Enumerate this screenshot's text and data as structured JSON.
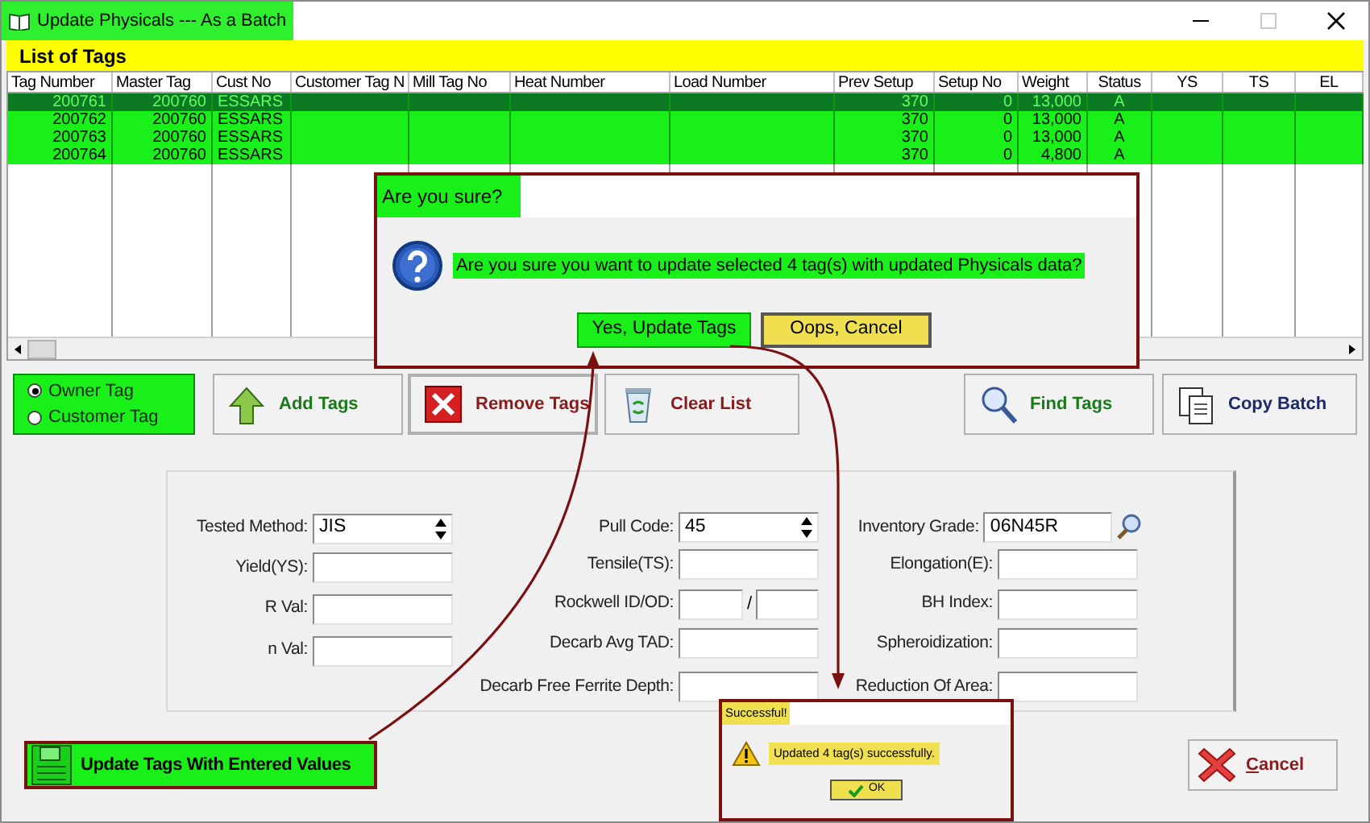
{
  "window": {
    "title": "Update Physicals --- As a Batch"
  },
  "list_header": "List of Tags",
  "table": {
    "columns": [
      "Tag Number",
      "Master Tag",
      "Cust No",
      "Customer Tag N",
      "Mill Tag No",
      "Heat Number",
      "Load Number",
      "Prev Setup",
      "Setup No",
      "Weight",
      "Status",
      "YS",
      "TS",
      "EL"
    ],
    "rows": [
      {
        "selected": true,
        "cells": [
          "200761",
          "200760",
          "ESSARS",
          "",
          "",
          "",
          "",
          "370",
          "0",
          "13,000",
          "A",
          "",
          "",
          ""
        ]
      },
      {
        "selected": false,
        "cells": [
          "200762",
          "200760",
          "ESSARS",
          "",
          "",
          "",
          "",
          "370",
          "0",
          "13,000",
          "A",
          "",
          "",
          ""
        ]
      },
      {
        "selected": false,
        "cells": [
          "200763",
          "200760",
          "ESSARS",
          "",
          "",
          "",
          "",
          "370",
          "0",
          "13,000",
          "A",
          "",
          "",
          ""
        ]
      },
      {
        "selected": false,
        "cells": [
          "200764",
          "200760",
          "ESSARS",
          "",
          "",
          "",
          "",
          "370",
          "0",
          "4,800",
          "A",
          "",
          "",
          ""
        ]
      }
    ]
  },
  "tag_type": [
    {
      "label": "Owner Tag",
      "selected": true
    },
    {
      "label": "Customer Tag",
      "selected": false
    }
  ],
  "buttons": [
    {
      "kind": "add",
      "label": "Add Tags"
    },
    {
      "kind": "remove",
      "label": "Remove Tags"
    },
    {
      "kind": "clear",
      "label": "Clear List"
    },
    {
      "kind": "find",
      "label": "Find Tags"
    },
    {
      "kind": "copy",
      "label": "Copy Batch"
    }
  ],
  "form": {
    "columns": [
      [
        {
          "label": "Tested Method:",
          "kind": "spinner",
          "value": "JIS"
        },
        {
          "label": "Yield(YS):",
          "kind": "text"
        },
        {
          "label": "R Val:",
          "kind": "text"
        },
        {
          "label": "n Val:",
          "kind": "text"
        }
      ],
      [
        {
          "label": "Pull Code:",
          "kind": "spinner",
          "value": "45"
        },
        {
          "label": "Tensile(TS):",
          "kind": "text"
        },
        {
          "label": "Rockwell ID/OD:",
          "kind": "pair",
          "separator": "/"
        },
        {
          "label": "Decarb Avg TAD:",
          "kind": "text"
        },
        {
          "label": "Decarb Free Ferrite Depth:",
          "kind": "text"
        }
      ],
      [
        {
          "label": "Inventory Grade:",
          "kind": "lookup",
          "value": "06N45R"
        },
        {
          "label": "Elongation(E):",
          "kind": "text"
        },
        {
          "label": "BH Index:",
          "kind": "text"
        },
        {
          "label": "Spheroidization:",
          "kind": "text"
        },
        {
          "label": "Reduction Of Area:",
          "kind": "text"
        }
      ]
    ]
  },
  "update_button": "Update Tags With Entered Values",
  "cancel_button": {
    "mnemonic": "C",
    "rest": "ancel"
  },
  "confirm_dialog": {
    "title": "Are you sure?",
    "message": "Are you sure you want to update selected 4 tag(s) with updated Physicals data?",
    "buttons": [
      {
        "label": "Yes, Update Tags",
        "kind": "yes"
      },
      {
        "label": "Oops, Cancel",
        "kind": "cancel"
      }
    ]
  },
  "success_dialog": {
    "title": "Successful!",
    "message": "Updated 4 tag(s) successfully.",
    "button": "OK"
  }
}
